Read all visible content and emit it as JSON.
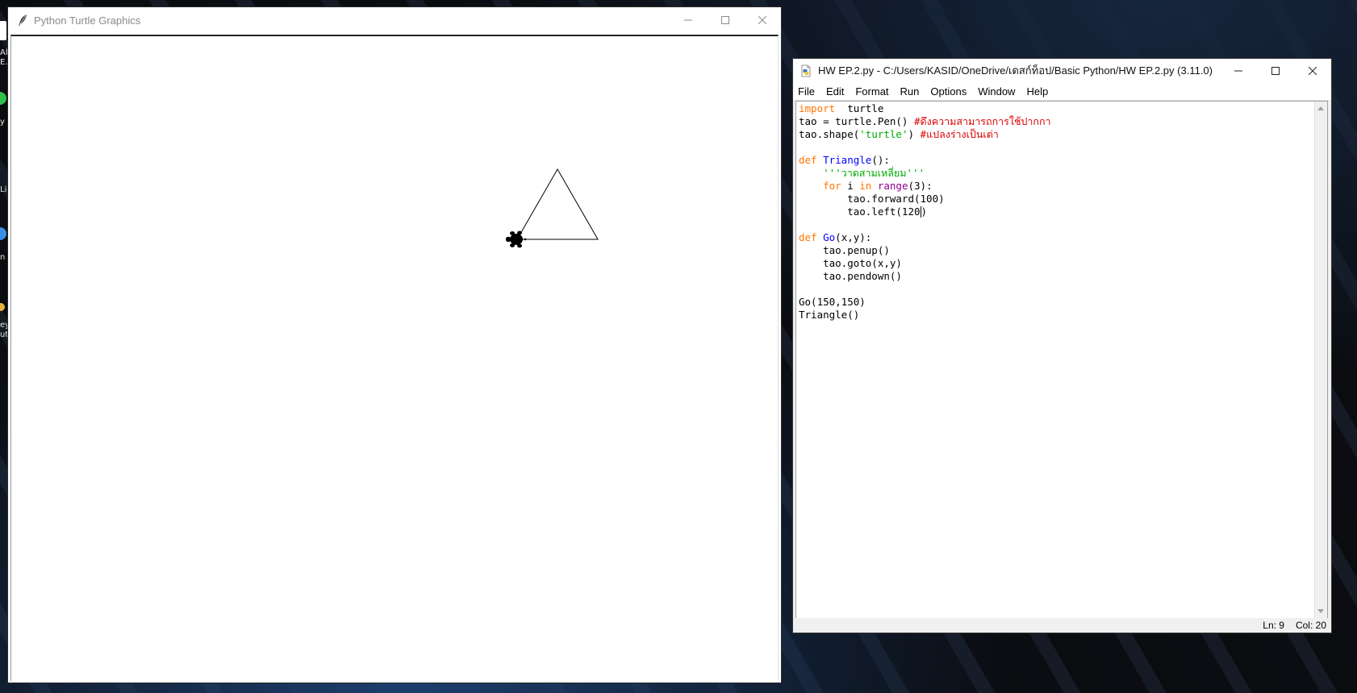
{
  "desktop": {
    "labels": [
      "Al",
      "E.",
      "y",
      "Li",
      "n",
      "ey",
      "ut"
    ]
  },
  "turtle_window": {
    "title": "Python Turtle Graphics",
    "app_icon": "feather-icon",
    "controls": [
      "minimize-icon",
      "maximize-icon",
      "close-icon"
    ]
  },
  "idle_window": {
    "title": "HW EP.2.py - C:/Users/KASID/OneDrive/เดสก์ท็อป/Basic Python/HW EP.2.py (3.11.0)",
    "app_icon": "python-file-icon",
    "controls": [
      "minimize-icon",
      "maximize-icon",
      "close-icon"
    ],
    "menu": [
      "File",
      "Edit",
      "Format",
      "Run",
      "Options",
      "Window",
      "Help"
    ],
    "status": {
      "line": "Ln: 9",
      "col": "Col: 20"
    }
  },
  "code_lines": [
    [
      [
        "kw",
        "import"
      ],
      [
        "",
        "  turtle"
      ]
    ],
    [
      [
        "",
        "tao = turtle.Pen() "
      ],
      [
        "cmt",
        "#ดึงความสามารถการใช้ปากกา"
      ]
    ],
    [
      [
        "",
        "tao.shape("
      ],
      [
        "str",
        "'turtle'"
      ],
      [
        "",
        ") "
      ],
      [
        "cmt",
        "#แปลงร่างเป็นเต่า"
      ]
    ],
    [],
    [
      [
        "kw",
        "def"
      ],
      [
        "",
        " "
      ],
      [
        "def",
        "Triangle"
      ],
      [
        "",
        "():"
      ]
    ],
    [
      [
        "",
        "    "
      ],
      [
        "str",
        "'''วาดสามเหลี่ยม'''"
      ]
    ],
    [
      [
        "",
        "    "
      ],
      [
        "kw",
        "for"
      ],
      [
        "",
        " i "
      ],
      [
        "kw",
        "in"
      ],
      [
        "",
        " "
      ],
      [
        "bi",
        "range"
      ],
      [
        "",
        "(3):"
      ]
    ],
    [
      [
        "",
        "        tao.forward(100)"
      ]
    ],
    [
      [
        "",
        "        tao.left(120"
      ],
      [
        "caret",
        ""
      ],
      [
        "",
        ")"
      ]
    ],
    [],
    [
      [
        "kw",
        "def"
      ],
      [
        "",
        " "
      ],
      [
        "def",
        "Go"
      ],
      [
        "",
        "(x,y):"
      ]
    ],
    [
      [
        "",
        "    tao.penup()"
      ]
    ],
    [
      [
        "",
        "    tao.goto(x,y)"
      ]
    ],
    [
      [
        "",
        "    tao.pendown()"
      ]
    ],
    [],
    [
      [
        "",
        "Go(150,150)"
      ]
    ],
    [
      [
        "",
        "Triangle()"
      ]
    ]
  ],
  "colors": {
    "keyword": "#ff7700",
    "builtin": "#900090",
    "definition": "#0000ff",
    "string": "#00aa00",
    "comment": "#dd0000"
  }
}
